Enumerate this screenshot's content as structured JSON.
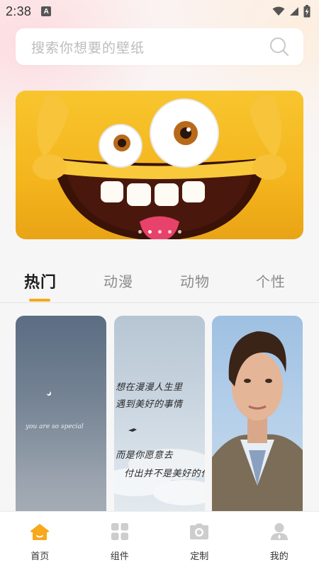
{
  "status_bar": {
    "time": "2:38",
    "notification_icon": "A"
  },
  "search": {
    "placeholder": "搜索你想要的壁纸"
  },
  "banner": {
    "icon": "smiley-monster-image",
    "page_count": 5,
    "active_index": 1
  },
  "tabs": [
    {
      "label": "热门"
    },
    {
      "label": "动漫"
    },
    {
      "label": "动物"
    },
    {
      "label": "个性"
    }
  ],
  "wallpapers": {
    "card1_caption": "you are so special",
    "card2_lines": [
      "想在漫漫人生里",
      "遇到美好的事情",
      "而是你愿意去",
      "付出并不是美好的代价"
    ]
  },
  "bottom_nav": [
    {
      "label": "首页",
      "icon": "home-icon",
      "color": "#f7a81d"
    },
    {
      "label": "组件",
      "icon": "grid-icon",
      "color": "#c9c9c9"
    },
    {
      "label": "定制",
      "icon": "camera-icon",
      "color": "#c9c9c9"
    },
    {
      "label": "我的",
      "icon": "person-icon",
      "color": "#c9c9c9"
    }
  ],
  "colors": {
    "accent": "#f7a81d"
  }
}
